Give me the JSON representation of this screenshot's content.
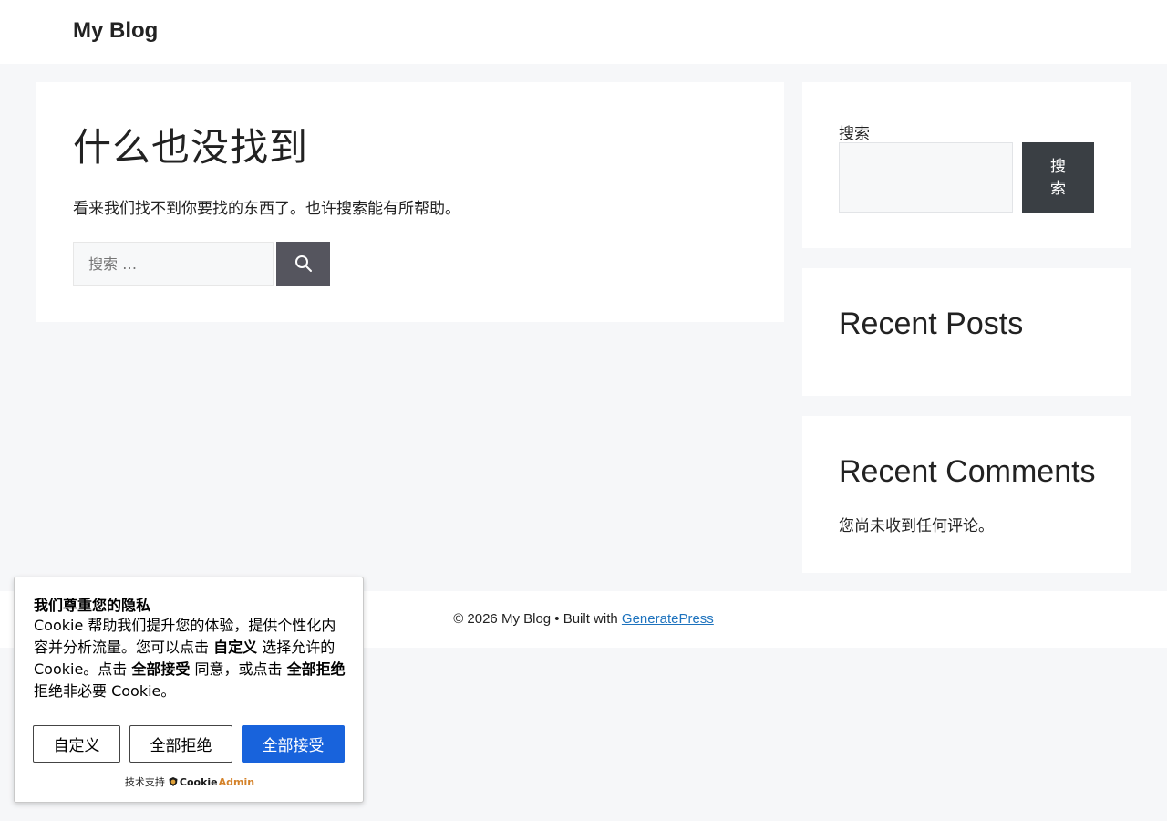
{
  "header": {
    "site_title": "My Blog"
  },
  "main": {
    "title": "什么也没找到",
    "message": "看来我们找不到你要找的东西了。也许搜索能有所帮助。",
    "search_placeholder": "搜索 …"
  },
  "sidebar": {
    "search_label": "搜索",
    "search_button": "搜索",
    "recent_posts_title": "Recent Posts",
    "recent_comments_title": "Recent Comments",
    "no_comments": "您尚未收到任何评论。"
  },
  "footer": {
    "text": "© 2026 My Blog • Built with ",
    "link": "GeneratePress"
  },
  "cookie": {
    "title": "我们尊重您的隐私",
    "desc_1": "Cookie 帮助我们提升您的体验，提供个性化内容并分析流量。您可以点击 ",
    "desc_b1": "自定义",
    "desc_2": " 选择允许的 Cookie。点击 ",
    "desc_b2": "全部接受",
    "desc_3": " 同意，或点击 ",
    "desc_b3": "全部拒绝",
    "desc_4": " 拒绝非必要 Cookie。",
    "btn_customize": "自定义",
    "btn_reject": "全部拒绝",
    "btn_accept": "全部接受",
    "powered_by": "技术支持",
    "logo_part1": "Cookie",
    "logo_part2": "Admin"
  },
  "colors": {
    "accept_blue": "#1863dc",
    "footer_link": "#1e73be",
    "search_button_dark": "#3a3f44"
  },
  "icons": {
    "main_search": "search-icon",
    "cookie_logo": "cookieadmin-logo-icon"
  }
}
